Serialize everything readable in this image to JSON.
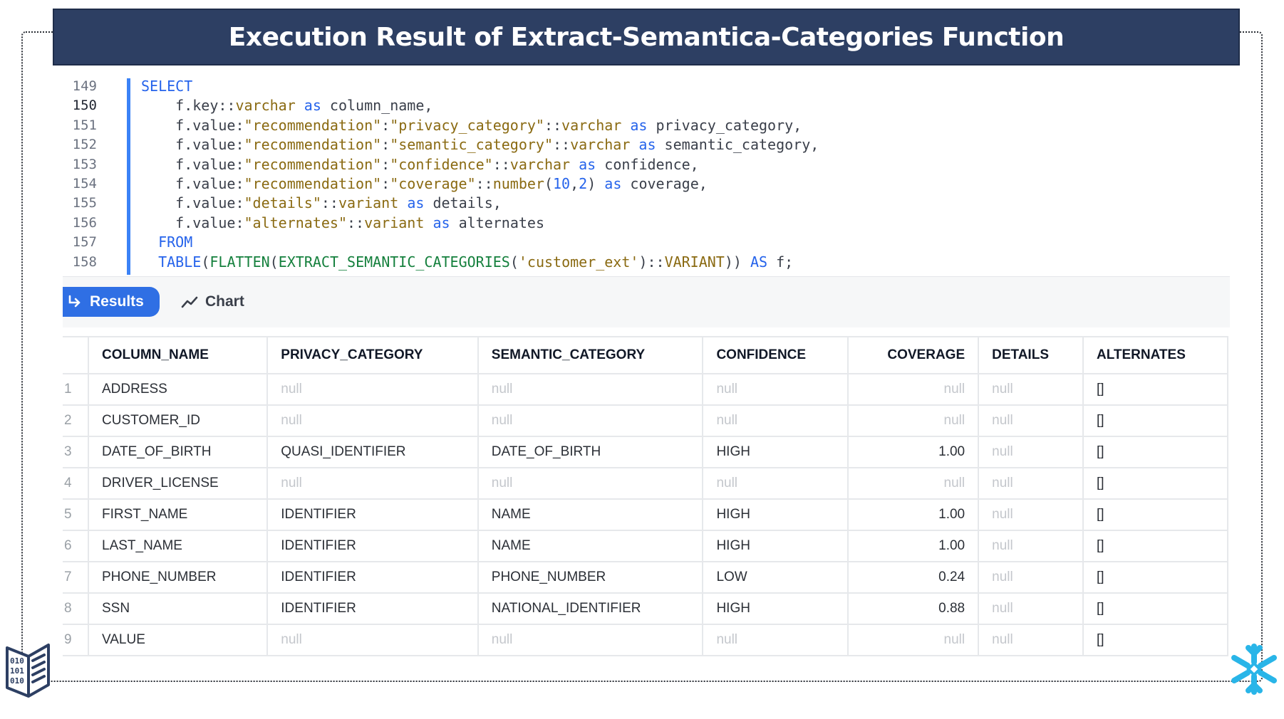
{
  "title": "Execution Result of Extract-Semantica-Categories Function",
  "editor": {
    "active_line": "150",
    "lines": [
      {
        "n": "149",
        "code": "SELECT"
      },
      {
        "n": "150",
        "code": "    f.key::varchar as column_name,"
      },
      {
        "n": "151",
        "code": "    f.value:\"recommendation\":\"privacy_category\"::varchar as privacy_category,"
      },
      {
        "n": "152",
        "code": "    f.value:\"recommendation\":\"semantic_category\"::varchar as semantic_category,"
      },
      {
        "n": "153",
        "code": "    f.value:\"recommendation\":\"confidence\"::varchar as confidence,"
      },
      {
        "n": "154",
        "code": "    f.value:\"recommendation\":\"coverage\"::number(10,2) as coverage,"
      },
      {
        "n": "155",
        "code": "    f.value:\"details\"::variant as details,"
      },
      {
        "n": "156",
        "code": "    f.value:\"alternates\"::variant as alternates"
      },
      {
        "n": "157",
        "code": "  FROM"
      },
      {
        "n": "158",
        "code": "  TABLE(FLATTEN(EXTRACT_SEMANTIC_CATEGORIES('customer_ext')::VARIANT)) AS f;"
      }
    ]
  },
  "tabs": {
    "results_label": "Results",
    "chart_label": "Chart",
    "results_icon": "return-arrow-icon",
    "chart_icon": "line-chart-icon"
  },
  "table": {
    "columns": [
      "COLUMN_NAME",
      "PRIVACY_CATEGORY",
      "SEMANTIC_CATEGORY",
      "CONFIDENCE",
      "COVERAGE",
      "DETAILS",
      "ALTERNATES"
    ],
    "rows": [
      {
        "n": "1",
        "cells": [
          "ADDRESS",
          "null",
          "null",
          "null",
          "null",
          "null",
          "[]"
        ]
      },
      {
        "n": "2",
        "cells": [
          "CUSTOMER_ID",
          "null",
          "null",
          "null",
          "null",
          "null",
          "[]"
        ]
      },
      {
        "n": "3",
        "cells": [
          "DATE_OF_BIRTH",
          "QUASI_IDENTIFIER",
          "DATE_OF_BIRTH",
          "HIGH",
          "1.00",
          "null",
          "[]"
        ]
      },
      {
        "n": "4",
        "cells": [
          "DRIVER_LICENSE",
          "null",
          "null",
          "null",
          "null",
          "null",
          "[]"
        ]
      },
      {
        "n": "5",
        "cells": [
          "FIRST_NAME",
          "IDENTIFIER",
          "NAME",
          "HIGH",
          "1.00",
          "null",
          "[]"
        ]
      },
      {
        "n": "6",
        "cells": [
          "LAST_NAME",
          "IDENTIFIER",
          "NAME",
          "HIGH",
          "1.00",
          "null",
          "[]"
        ]
      },
      {
        "n": "7",
        "cells": [
          "PHONE_NUMBER",
          "IDENTIFIER",
          "PHONE_NUMBER",
          "LOW",
          "0.24",
          "null",
          "[]"
        ]
      },
      {
        "n": "8",
        "cells": [
          "SSN",
          "IDENTIFIER",
          "NATIONAL_IDENTIFIER",
          "HIGH",
          "0.88",
          "null",
          "[]"
        ]
      },
      {
        "n": "9",
        "cells": [
          "VALUE",
          "null",
          "null",
          "null",
          "null",
          "null",
          "[]"
        ]
      }
    ]
  },
  "logos": {
    "left": "binary-book-logo-icon",
    "right": "snowflake-logo-icon"
  },
  "colors": {
    "banner": "#2d3f63",
    "accent": "#2f6fe4",
    "snowflake": "#29b5e8"
  }
}
